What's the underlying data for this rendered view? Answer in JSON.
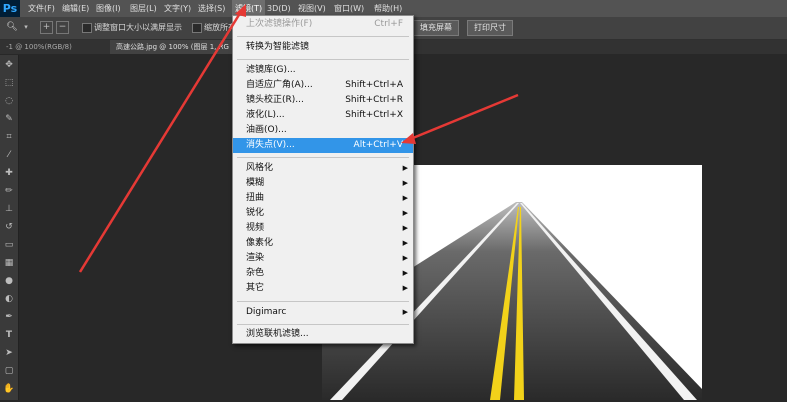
{
  "menubar": {
    "logo": "Ps",
    "items": [
      "文件(F)",
      "编辑(E)",
      "图像(I)",
      "图层(L)",
      "文字(Y)",
      "选择(S)",
      "滤镜(T)",
      "3D(D)",
      "视图(V)",
      "窗口(W)",
      "帮助(H)"
    ]
  },
  "options": {
    "resize_label": "调整窗口大小以满屏显示",
    "zoom_all_label": "缩放所有",
    "fill_screen": "填充屏幕",
    "print_size": "打印尺寸"
  },
  "tabs": [
    "-1 @ 100%(RGB/8)",
    "高速公路.jpg @ 100% (图层 1, RG"
  ],
  "filter_menu": {
    "last_filter": {
      "label": "上次滤镜操作(F)",
      "shortcut": "Ctrl+F"
    },
    "smart": "转换为智能滤镜",
    "gallery": "滤镜库(G)...",
    "adaptive_wide": {
      "label": "自适应广角(A)...",
      "shortcut": "Shift+Ctrl+A"
    },
    "lens_correction": {
      "label": "镜头校正(R)...",
      "shortcut": "Shift+Ctrl+R"
    },
    "liquify": {
      "label": "液化(L)...",
      "shortcut": "Shift+Ctrl+X"
    },
    "oil_paint": "油画(O)...",
    "vanishing_point": {
      "label": "消失点(V)...",
      "shortcut": "Alt+Ctrl+V"
    },
    "submenus": [
      "风格化",
      "模糊",
      "扭曲",
      "锐化",
      "视频",
      "像素化",
      "渲染",
      "杂色",
      "其它"
    ],
    "digimarc": "Digimarc",
    "browse_online": "浏览联机滤镜..."
  },
  "colors": {
    "highlight": "#3295e8",
    "arrow": "#e53935"
  }
}
